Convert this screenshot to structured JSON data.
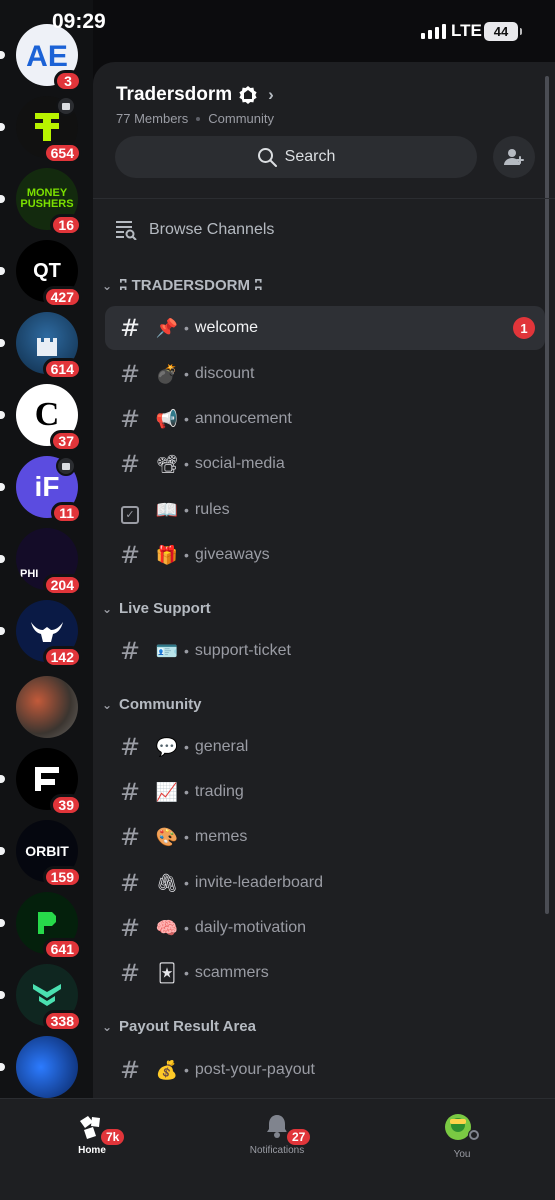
{
  "status_bar": {
    "time": "09:29",
    "network": "LTE",
    "battery": "44"
  },
  "servers": [
    {
      "label": "AE",
      "count": "3",
      "bg": "#e9edf5",
      "fg": "#1b62d6"
    },
    {
      "label": "",
      "count": "654",
      "bg": "#111",
      "fg": "#b8f400",
      "event": true
    },
    {
      "label": "MONEY PUSHERS",
      "count": "16",
      "bg": "#1b3a12",
      "fg": "#6fe000"
    },
    {
      "label": "QT",
      "count": "427",
      "bg": "#000",
      "fg": "#fff"
    },
    {
      "label": "",
      "count": "614",
      "bg": "#1d4b73",
      "fg": "#fff"
    },
    {
      "label": "C",
      "count": "37",
      "bg": "#fff",
      "fg": "#000"
    },
    {
      "label": "iF",
      "count": "11",
      "bg": "#5b4ce0",
      "fg": "#fff",
      "event": true
    },
    {
      "label": "PHI",
      "count": "204",
      "bg": "#1a1030",
      "fg": "#b36cff"
    },
    {
      "label": "",
      "count": "142",
      "bg": "#0c1b4a",
      "fg": "#fff"
    },
    {
      "label": "",
      "count": "",
      "bg": "#6b4a3a",
      "fg": "#fff"
    },
    {
      "label": "F",
      "count": "39",
      "bg": "#000",
      "fg": "#fff"
    },
    {
      "label": "ORBIT",
      "count": "159",
      "bg": "#05070f",
      "fg": "#fff"
    },
    {
      "label": "P",
      "count": "641",
      "bg": "#052b10",
      "fg": "#27d94a"
    },
    {
      "label": "",
      "count": "338",
      "bg": "#12302a",
      "fg": "#4ae0b0"
    },
    {
      "label": "",
      "count": "",
      "bg": "#0b2d7a",
      "fg": "#4aa5ff"
    }
  ],
  "guild": {
    "name": "Tradersdorm",
    "members": "77 Members",
    "type": "Community",
    "search_label": "Search",
    "browse_label": "Browse Channels"
  },
  "categories": [
    {
      "name": "ʭ TRADERSDORM ʭ"
    },
    {
      "name": "Live Support"
    },
    {
      "name": "Community"
    },
    {
      "name": "Payout Result Area"
    }
  ],
  "channels": [
    {
      "emoji": "📌",
      "name": "welcome",
      "unread": "1",
      "active": true
    },
    {
      "emoji": "💣",
      "name": "discount"
    },
    {
      "emoji": "📢",
      "name": "annoucement"
    },
    {
      "emoji": "📽",
      "name": "social-media"
    },
    {
      "emoji": "📖",
      "name": "rules",
      "kind": "rules"
    },
    {
      "emoji": "🎁",
      "name": "giveaways"
    },
    {
      "emoji": "🪪",
      "name": "support-ticket"
    },
    {
      "emoji": "💬",
      "name": "general"
    },
    {
      "emoji": "📈",
      "name": "trading"
    },
    {
      "emoji": "🎨",
      "name": "memes"
    },
    {
      "emoji": "🖇",
      "name": "invite-leaderboard"
    },
    {
      "emoji": "🧠",
      "name": "daily-motivation"
    },
    {
      "emoji": "🃏",
      "name": "scammers"
    },
    {
      "emoji": "💰",
      "name": "post-your-payout"
    }
  ],
  "tabs": {
    "home": {
      "label": "Home",
      "badge": "7k"
    },
    "notifications": {
      "label": "Notifications",
      "badge": "27"
    },
    "you": {
      "label": "You"
    }
  },
  "colors": {
    "accent_red": "#e1353a",
    "panel": "#1e1f22",
    "rail": "#111214"
  }
}
